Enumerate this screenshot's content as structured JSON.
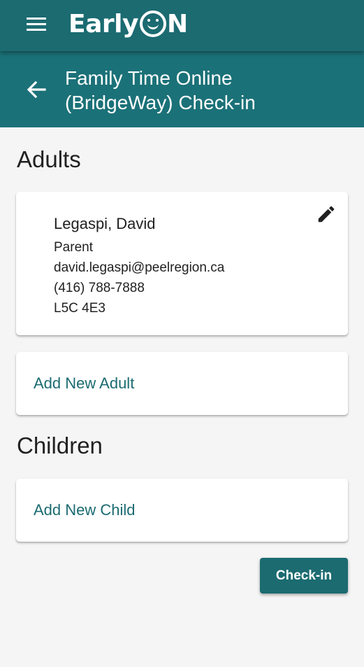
{
  "app": {
    "logo_text_left": "Early",
    "logo_text_right": "N",
    "menu_icon": "hamburger-menu-icon"
  },
  "header": {
    "back_icon": "arrow-left-icon",
    "title_line1": "Family Time Online",
    "title_line2": "(BridgeWay) Check-in"
  },
  "adults": {
    "section_title": "Adults",
    "items": [
      {
        "name": "Legaspi, David",
        "role": "Parent",
        "email": "david.legaspi@peelregion.ca",
        "phone": "(416) 788-7888",
        "postal_code": "L5C 4E3",
        "edit_icon": "pencil-icon"
      }
    ],
    "add_label": "Add New Adult"
  },
  "children": {
    "section_title": "Children",
    "add_label": "Add New Child"
  },
  "actions": {
    "checkin_label": "Check-in"
  },
  "colors": {
    "primary": "#1b6b71",
    "header_bar": "#1b7178",
    "background": "#f5f5f5",
    "card": "#ffffff"
  }
}
